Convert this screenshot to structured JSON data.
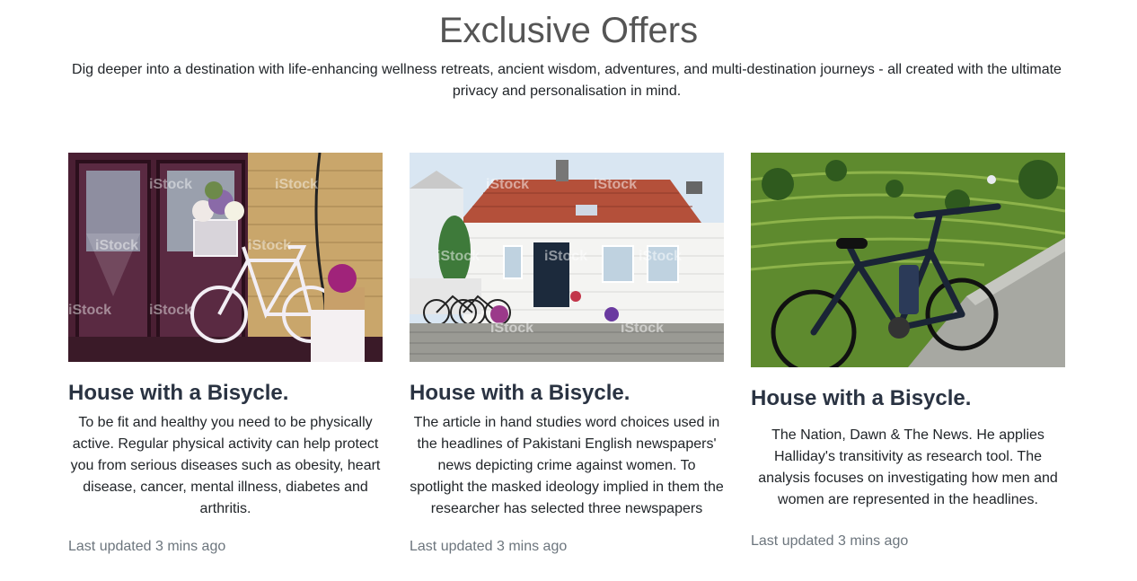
{
  "section": {
    "title": "Exclusive Offers",
    "intro": "Dig deeper into a destination with life-enhancing wellness retreats, ancient wisdom, adventures, and multi-destination journeys - all created with the ultimate privacy and personalisation in mind."
  },
  "cards": [
    {
      "image": "bicycle-with-flowers-photo",
      "title": "House with a Bisycle.",
      "text": "To be fit and healthy you need to be physically active. Regular physical activity can help protect you from serious diseases such as obesity, heart disease, cancer, mental illness, diabetes and arthritis.",
      "meta": "Last updated 3 mins ago"
    },
    {
      "image": "white-house-photo",
      "title": "House with a Bisycle.",
      "text": "The article in hand studies word choices used in the headlines of Pakistani English newspapers' news depicting crime against women. To spotlight the masked ideology implied in them the researcher has selected three newspapers",
      "meta": "Last updated 3 mins ago"
    },
    {
      "image": "ebike-rice-terraces-photo",
      "title": "House with a Bisycle.",
      "text": "The Nation, Dawn & The News. He applies Halliday's transitivity as research tool. The analysis focuses on investigating how men and women are represented in the headlines.",
      "meta": "Last updated 3 mins ago"
    }
  ],
  "watermark": "iStock"
}
